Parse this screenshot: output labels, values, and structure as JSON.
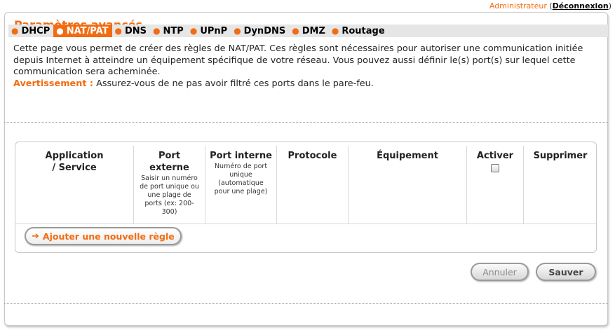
{
  "topbar": {
    "admin": "Administrateur",
    "logout": "Déconnexion"
  },
  "panel": {
    "title": "Paramètres avancés"
  },
  "tabs": [
    {
      "label": "DHCP",
      "active": false
    },
    {
      "label": "NAT/PAT",
      "active": true
    },
    {
      "label": "DNS",
      "active": false
    },
    {
      "label": "NTP",
      "active": false
    },
    {
      "label": "UPnP",
      "active": false
    },
    {
      "label": "DynDNS",
      "active": false
    },
    {
      "label": "DMZ",
      "active": false
    },
    {
      "label": "Routage",
      "active": false
    }
  ],
  "description": {
    "text": "Cette page vous permet de créer des règles de NAT/PAT. Ces règles sont nécessaires pour autoriser une communication initiée depuis Internet à atteindre un équipement spécifique de votre réseau. Vous pouvez aussi définir le(s) port(s) sur lequel cette communication sera acheminée.",
    "warning_label": "Avertissement :",
    "warning_text": " Assurez-vous de ne pas avoir filtré ces ports dans le pare-feu."
  },
  "table": {
    "headers": {
      "application": "Application / Service",
      "external_port": "Port externe",
      "external_port_hint": "Saisir un numéro de port unique ou une plage de ports (ex: 200-300)",
      "internal_port": "Port interne",
      "internal_port_hint": "Numéro de port unique (automatique pour une plage)",
      "protocol": "Protocole",
      "device": "Équipement",
      "enable": "Activer",
      "delete": "Supprimer"
    },
    "enable_all_checked": false,
    "add_rule_label": "Ajouter une nouvelle règle"
  },
  "buttons": {
    "cancel": "Annuler",
    "save": "Sauver"
  },
  "colors": {
    "accent": "#f26c11",
    "tab_bar": "#e6e6e6"
  }
}
